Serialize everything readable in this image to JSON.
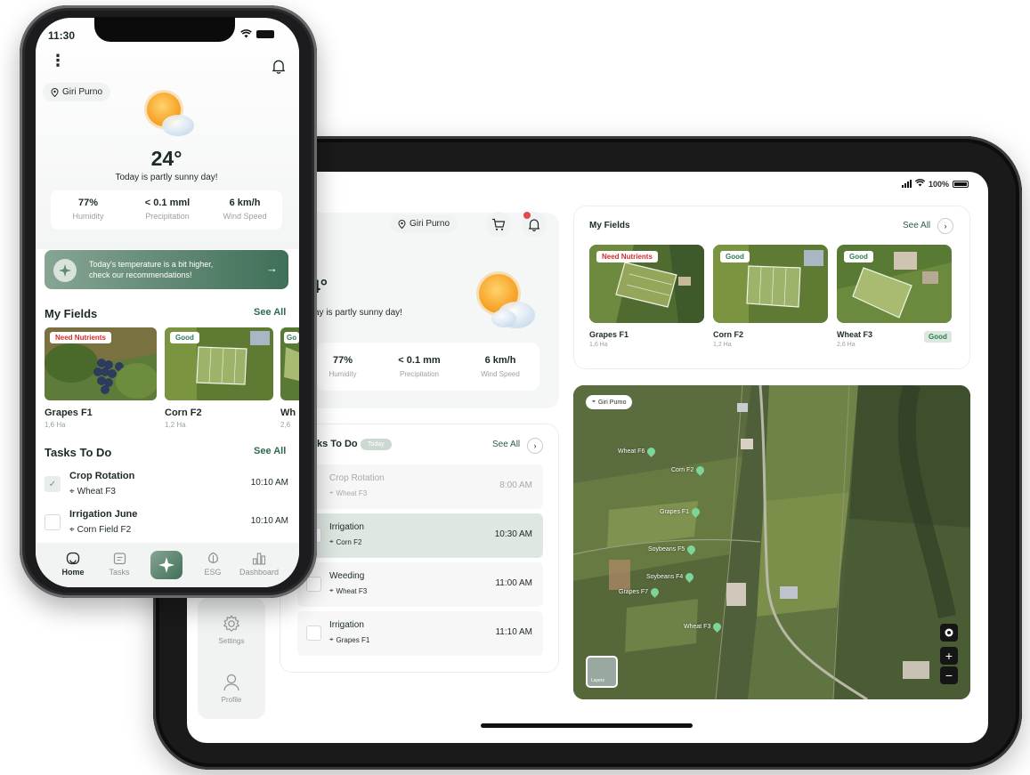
{
  "tablet": {
    "status_battery": "100%",
    "location": "Giri Purno",
    "weather": {
      "temp": "4°",
      "desc": "ay is partly sunny day!",
      "stats": [
        {
          "value": "77%",
          "label": "Humidity"
        },
        {
          "value": "< 0.1 mm",
          "label": "Precipitation"
        },
        {
          "value": "6 km/h",
          "label": "Wind Speed"
        }
      ]
    },
    "tasks": {
      "title": "ks To Do",
      "pill": "Today",
      "see_all": "See All",
      "items": [
        {
          "name": "Crop Rotation",
          "location": "Wheat F3",
          "time": "8:00 AM"
        },
        {
          "name": "Irrigation",
          "location": "Corn F2",
          "time": "10:30 AM"
        },
        {
          "name": "Weeding",
          "location": "Wheat F3",
          "time": "11:00 AM"
        },
        {
          "name": "Irrigation",
          "location": "Grapes F1",
          "time": "11:10 AM"
        }
      ]
    },
    "fields": {
      "title": "My Fields",
      "see_all": "See All",
      "items": [
        {
          "badge": "Need Nutrients",
          "name": "Grapes F1",
          "size": "1,6 Ha"
        },
        {
          "badge": "Good",
          "name": "Corn F2",
          "size": "1,2 Ha"
        },
        {
          "badge": "Good",
          "name": "Wheat F3",
          "size": "2,6 Ha",
          "status": "Good"
        }
      ]
    },
    "map": {
      "location": "Giri Purno",
      "labels": [
        "Wheat F6",
        "Corn F2",
        "Grapes F1",
        "Soybeans F5",
        "Soybeans F4",
        "Grapes F7",
        "Wheat F3"
      ],
      "layers": "Layers",
      "zoom_in": "+",
      "zoom_out": "−"
    },
    "sidebar": [
      {
        "label": "Settings",
        "icon": "gear-icon"
      },
      {
        "label": "Profile",
        "icon": "user-icon"
      }
    ]
  },
  "phone": {
    "time": "11:30",
    "location": "Giri Purno",
    "weather": {
      "temp": "24°",
      "desc": "Today is partly sunny day!",
      "stats": [
        {
          "value": "77%",
          "label": "Humidity"
        },
        {
          "value": "< 0.1 mml",
          "label": "Precipitation"
        },
        {
          "value": "6 km/h",
          "label": "Wind Speed"
        }
      ]
    },
    "banner": {
      "line1": "Today's temperature is a bit higher,",
      "line2": "check our recommendations!"
    },
    "fields": {
      "title": "My Fields",
      "see_all": "See All",
      "items": [
        {
          "badge": "Need Nutrients",
          "name": "Grapes F1",
          "size": "1,6 Ha"
        },
        {
          "badge": "Good",
          "name": "Corn F2",
          "size": "1,2 Ha"
        },
        {
          "badge": "Go",
          "name": "Wh",
          "size": "2,6"
        }
      ]
    },
    "tasks": {
      "title": "Tasks To Do",
      "see_all": "See All",
      "items": [
        {
          "name": "Crop Rotation",
          "location": "Wheat F3",
          "time": "10:10 AM",
          "checked": true
        },
        {
          "name": "Irrigation June",
          "location": "Corn Field F2",
          "time": "10:10 AM",
          "checked": false
        }
      ]
    },
    "nav": [
      {
        "label": "Home",
        "icon": "home-icon"
      },
      {
        "label": "Tasks",
        "icon": "calendar-icon"
      },
      {
        "label": "ESG",
        "icon": "leaf-icon"
      },
      {
        "label": "Dashboard",
        "icon": "chart-icon"
      }
    ]
  },
  "colors": {
    "brand": "#3f6f58",
    "brand_light": "#86a593",
    "alert": "#d62b2b",
    "good": "#2e7d4f"
  }
}
